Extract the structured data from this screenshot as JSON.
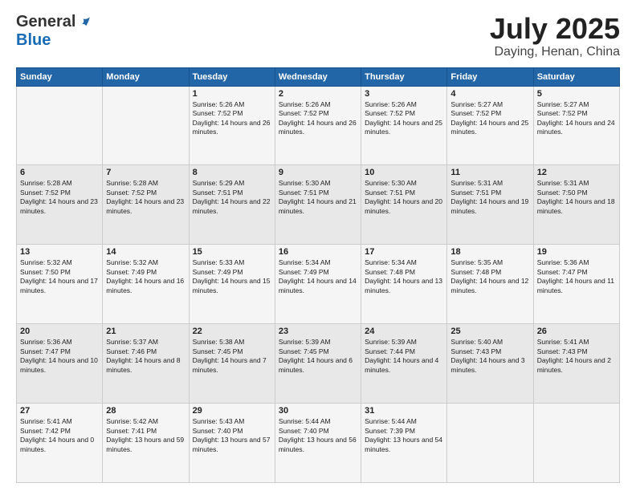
{
  "logo": {
    "general": "General",
    "blue": "Blue"
  },
  "header": {
    "month": "July 2025",
    "location": "Daying, Henan, China"
  },
  "weekdays": [
    "Sunday",
    "Monday",
    "Tuesday",
    "Wednesday",
    "Thursday",
    "Friday",
    "Saturday"
  ],
  "weeks": [
    [
      {
        "day": "",
        "info": ""
      },
      {
        "day": "",
        "info": ""
      },
      {
        "day": "1",
        "info": "Sunrise: 5:26 AM\nSunset: 7:52 PM\nDaylight: 14 hours and 26 minutes."
      },
      {
        "day": "2",
        "info": "Sunrise: 5:26 AM\nSunset: 7:52 PM\nDaylight: 14 hours and 26 minutes."
      },
      {
        "day": "3",
        "info": "Sunrise: 5:26 AM\nSunset: 7:52 PM\nDaylight: 14 hours and 25 minutes."
      },
      {
        "day": "4",
        "info": "Sunrise: 5:27 AM\nSunset: 7:52 PM\nDaylight: 14 hours and 25 minutes."
      },
      {
        "day": "5",
        "info": "Sunrise: 5:27 AM\nSunset: 7:52 PM\nDaylight: 14 hours and 24 minutes."
      }
    ],
    [
      {
        "day": "6",
        "info": "Sunrise: 5:28 AM\nSunset: 7:52 PM\nDaylight: 14 hours and 23 minutes."
      },
      {
        "day": "7",
        "info": "Sunrise: 5:28 AM\nSunset: 7:52 PM\nDaylight: 14 hours and 23 minutes."
      },
      {
        "day": "8",
        "info": "Sunrise: 5:29 AM\nSunset: 7:51 PM\nDaylight: 14 hours and 22 minutes."
      },
      {
        "day": "9",
        "info": "Sunrise: 5:30 AM\nSunset: 7:51 PM\nDaylight: 14 hours and 21 minutes."
      },
      {
        "day": "10",
        "info": "Sunrise: 5:30 AM\nSunset: 7:51 PM\nDaylight: 14 hours and 20 minutes."
      },
      {
        "day": "11",
        "info": "Sunrise: 5:31 AM\nSunset: 7:51 PM\nDaylight: 14 hours and 19 minutes."
      },
      {
        "day": "12",
        "info": "Sunrise: 5:31 AM\nSunset: 7:50 PM\nDaylight: 14 hours and 18 minutes."
      }
    ],
    [
      {
        "day": "13",
        "info": "Sunrise: 5:32 AM\nSunset: 7:50 PM\nDaylight: 14 hours and 17 minutes."
      },
      {
        "day": "14",
        "info": "Sunrise: 5:32 AM\nSunset: 7:49 PM\nDaylight: 14 hours and 16 minutes."
      },
      {
        "day": "15",
        "info": "Sunrise: 5:33 AM\nSunset: 7:49 PM\nDaylight: 14 hours and 15 minutes."
      },
      {
        "day": "16",
        "info": "Sunrise: 5:34 AM\nSunset: 7:49 PM\nDaylight: 14 hours and 14 minutes."
      },
      {
        "day": "17",
        "info": "Sunrise: 5:34 AM\nSunset: 7:48 PM\nDaylight: 14 hours and 13 minutes."
      },
      {
        "day": "18",
        "info": "Sunrise: 5:35 AM\nSunset: 7:48 PM\nDaylight: 14 hours and 12 minutes."
      },
      {
        "day": "19",
        "info": "Sunrise: 5:36 AM\nSunset: 7:47 PM\nDaylight: 14 hours and 11 minutes."
      }
    ],
    [
      {
        "day": "20",
        "info": "Sunrise: 5:36 AM\nSunset: 7:47 PM\nDaylight: 14 hours and 10 minutes."
      },
      {
        "day": "21",
        "info": "Sunrise: 5:37 AM\nSunset: 7:46 PM\nDaylight: 14 hours and 8 minutes."
      },
      {
        "day": "22",
        "info": "Sunrise: 5:38 AM\nSunset: 7:45 PM\nDaylight: 14 hours and 7 minutes."
      },
      {
        "day": "23",
        "info": "Sunrise: 5:39 AM\nSunset: 7:45 PM\nDaylight: 14 hours and 6 minutes."
      },
      {
        "day": "24",
        "info": "Sunrise: 5:39 AM\nSunset: 7:44 PM\nDaylight: 14 hours and 4 minutes."
      },
      {
        "day": "25",
        "info": "Sunrise: 5:40 AM\nSunset: 7:43 PM\nDaylight: 14 hours and 3 minutes."
      },
      {
        "day": "26",
        "info": "Sunrise: 5:41 AM\nSunset: 7:43 PM\nDaylight: 14 hours and 2 minutes."
      }
    ],
    [
      {
        "day": "27",
        "info": "Sunrise: 5:41 AM\nSunset: 7:42 PM\nDaylight: 14 hours and 0 minutes."
      },
      {
        "day": "28",
        "info": "Sunrise: 5:42 AM\nSunset: 7:41 PM\nDaylight: 13 hours and 59 minutes."
      },
      {
        "day": "29",
        "info": "Sunrise: 5:43 AM\nSunset: 7:40 PM\nDaylight: 13 hours and 57 minutes."
      },
      {
        "day": "30",
        "info": "Sunrise: 5:44 AM\nSunset: 7:40 PM\nDaylight: 13 hours and 56 minutes."
      },
      {
        "day": "31",
        "info": "Sunrise: 5:44 AM\nSunset: 7:39 PM\nDaylight: 13 hours and 54 minutes."
      },
      {
        "day": "",
        "info": ""
      },
      {
        "day": "",
        "info": ""
      }
    ]
  ]
}
